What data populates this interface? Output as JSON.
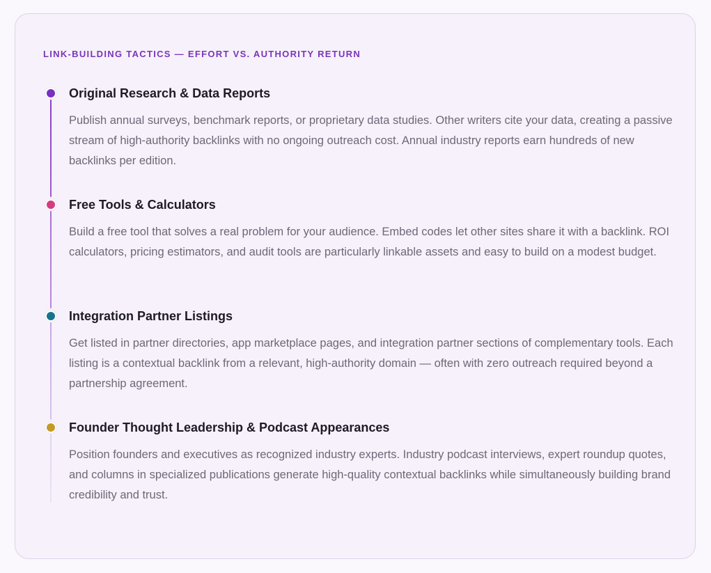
{
  "eyebrow": "LINK-BUILDING TACTICS — EFFORT VS. AUTHORITY RETURN",
  "colors": {
    "accent": "#7b35b9",
    "dot_1": "#7b2fbf",
    "dot_2": "#d63b82",
    "dot_3": "#17748c",
    "dot_4": "#c49a28"
  },
  "items": [
    {
      "title": "Original Research & Data Reports",
      "description": "Publish annual surveys, benchmark reports, or proprietary data studies. Other writers cite your data, creating a passive stream of high-authority backlinks with no ongoing outreach cost. Annual industry reports earn hundreds of new backlinks per edition."
    },
    {
      "title": "Free Tools & Calculators",
      "description": "Build a free tool that solves a real problem for your audience. Embed codes let other sites share it with a backlink. ROI calculators, pricing estimators, and audit tools are particularly linkable assets and easy to build on a modest budget."
    },
    {
      "title": "Integration Partner Listings",
      "description": "Get listed in partner directories, app marketplace pages, and integration partner sections of complementary tools. Each listing is a contextual backlink from a relevant, high-authority domain — often with zero outreach required beyond a partnership agreement."
    },
    {
      "title": "Founder Thought Leadership & Podcast Appearances",
      "description": "Position founders and executives as recognized industry experts. Industry podcast interviews, expert roundup quotes, and columns in specialized publications generate high-quality contextual backlinks while simultaneously building brand credibility and trust."
    }
  ]
}
